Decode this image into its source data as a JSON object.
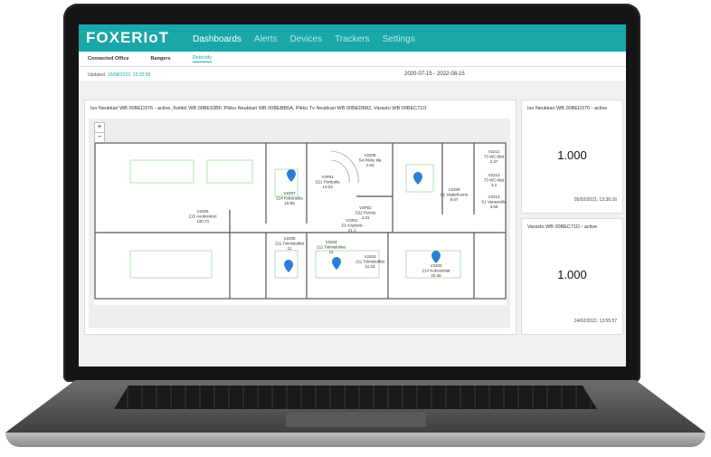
{
  "app": {
    "logo": "FOXERIoT",
    "nav": [
      "Dashboards",
      "Alerts",
      "Devices",
      "Trackers",
      "Settings"
    ],
    "active_nav": "Dashboards"
  },
  "tabs": [
    "Connected Office",
    "Rangers",
    "Detectify"
  ],
  "active_tab": "Detectify",
  "updated": {
    "label": "Updated",
    "value": "15/08/2022, 15:32:58"
  },
  "date_range": "2020-07-15  -  2022-08-15",
  "map_panel": {
    "title": "Iso Neukkari WB 00BED376 - active, Keittiö WB 00BE93BF, Pikku Neukkari WB 00BEBB5A, Pikku Tv Neukkari WB 00BEDB82, Varasto WB 00BEC71D",
    "zoom_in": "+",
    "zoom_out": "−",
    "rooms": [
      {
        "code": "V2206",
        "name": "215 Avokonttori",
        "area": "130.73"
      },
      {
        "code": "V2207",
        "name": "214 Kokoustila",
        "area": "10.96"
      },
      {
        "code": "V2P01",
        "name": "S21 Porttotila",
        "area": "13.03"
      },
      {
        "code": "V2208",
        "name": "S4 Pikku tila",
        "area": "2.63"
      },
      {
        "code": "V2P02",
        "name": "S22 Porras",
        "area": "4.31"
      },
      {
        "code": "V2201",
        "name": "S1 Käytävä",
        "area": "21.1"
      },
      {
        "code": "V2209",
        "name": "S1 Vaatehuone",
        "area": "8.07"
      },
      {
        "code": "V2211",
        "name": "73 WC-tilat",
        "area": "2.37"
      },
      {
        "code": "V2212",
        "name": "73 WC-tilat",
        "area": "3.2"
      },
      {
        "code": "V2213",
        "name": "S1 Varastotila",
        "area": "3.65"
      },
      {
        "code": "V2205",
        "name": "211 Toimistotilat",
        "area": "11"
      },
      {
        "code": "V2204",
        "name": "211 Toimistotilat",
        "area": "11"
      },
      {
        "code": "V2203",
        "name": "211 Toimistotilat",
        "area": "11.03"
      },
      {
        "code": "V2202",
        "name": "214 Kokoustilat",
        "area": "22.46"
      }
    ]
  },
  "stat_panels": [
    {
      "title": "Iso Neukkari WB 00BED376 - active",
      "value": "1.000",
      "time": "05/02/2021, 13:36:16"
    },
    {
      "title": "Varasto WB 00BEC71D - active",
      "value": "1.000",
      "time": "24/02/2022, 13:55:57"
    }
  ],
  "colors": {
    "brand": "#19a7a7",
    "pin": "#2a7fd4"
  }
}
